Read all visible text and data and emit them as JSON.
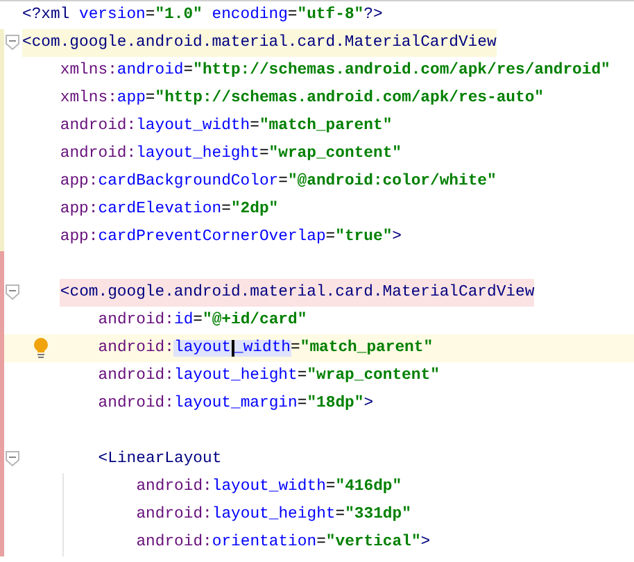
{
  "lines": [
    {
      "tokens": [
        {
          "kind": "bracket",
          "text": "<?"
        },
        {
          "kind": "tag",
          "text": "xml"
        },
        {
          "kind": "attr",
          "text": "version",
          "spaced": true
        },
        {
          "kind": "eq",
          "text": "="
        },
        {
          "kind": "value",
          "text": "\"1.0\""
        },
        {
          "kind": "attr",
          "text": "encoding",
          "spaced": true
        },
        {
          "kind": "eq",
          "text": "="
        },
        {
          "kind": "value",
          "text": "\"utf-8\""
        },
        {
          "kind": "bracket",
          "text": "?>"
        }
      ]
    },
    {
      "fold": true,
      "matched": true,
      "color": "#f3efc8",
      "tokens": [
        {
          "kind": "bracket",
          "text": "<"
        },
        {
          "kind": "tag",
          "text": "com.google.android.material.card.MaterialCardView"
        }
      ],
      "children": [
        {
          "color": "#f3efc8",
          "tokens": [
            {
              "kind": "ns",
              "text": "xmlns:"
            },
            {
              "kind": "attr",
              "text": "android"
            },
            {
              "kind": "eq",
              "text": "="
            },
            {
              "kind": "value",
              "text": "\"http://schemas.android.com/apk/res/android\""
            }
          ]
        },
        {
          "color": "#f3efc8",
          "tokens": [
            {
              "kind": "ns",
              "text": "xmlns:"
            },
            {
              "kind": "attr",
              "text": "app"
            },
            {
              "kind": "eq",
              "text": "="
            },
            {
              "kind": "value",
              "text": "\"http://schemas.android.com/apk/res-auto\""
            }
          ]
        },
        {
          "color": "#f3efc8",
          "tokens": [
            {
              "kind": "ns",
              "text": "android:"
            },
            {
              "kind": "attr",
              "text": "layout_width"
            },
            {
              "kind": "eq",
              "text": "="
            },
            {
              "kind": "value",
              "text": "\"match_parent\""
            }
          ]
        },
        {
          "color": "#f3efc8",
          "tokens": [
            {
              "kind": "ns",
              "text": "android:"
            },
            {
              "kind": "attr",
              "text": "layout_height"
            },
            {
              "kind": "eq",
              "text": "="
            },
            {
              "kind": "value",
              "text": "\"wrap_content\""
            }
          ]
        },
        {
          "color": "#f3efc8",
          "tokens": [
            {
              "kind": "ns",
              "text": "app:"
            },
            {
              "kind": "attr",
              "text": "cardBackgroundColor"
            },
            {
              "kind": "eq",
              "text": "="
            },
            {
              "kind": "value",
              "text": "\"@android:color/white\""
            }
          ]
        },
        {
          "color": "#f3efc8",
          "tokens": [
            {
              "kind": "ns",
              "text": "app:"
            },
            {
              "kind": "attr",
              "text": "cardElevation"
            },
            {
              "kind": "eq",
              "text": "="
            },
            {
              "kind": "value",
              "text": "\"2dp\""
            }
          ]
        },
        {
          "color": "#f3efc8",
          "tokens": [
            {
              "kind": "ns",
              "text": "app:"
            },
            {
              "kind": "attr",
              "text": "cardPreventCornerOverlap"
            },
            {
              "kind": "eq",
              "text": "="
            },
            {
              "kind": "value",
              "text": "\"true\""
            },
            {
              "kind": "bracket",
              "text": ">"
            }
          ]
        },
        {
          "color": "#e8a0a0"
        },
        {
          "fold": true,
          "error": true,
          "color": "#e8a0a0",
          "tokens": [
            {
              "kind": "bracket",
              "text": "<"
            },
            {
              "kind": "tag",
              "text": "com.google.android.material.card.MaterialCardView"
            }
          ],
          "children": [
            {
              "color": "#e8a0a0",
              "tokens": [
                {
                  "kind": "ns",
                  "text": "android:"
                },
                {
                  "kind": "attr",
                  "text": "id"
                },
                {
                  "kind": "eq",
                  "text": "="
                },
                {
                  "kind": "value",
                  "text": "\"@+id/card\""
                }
              ]
            },
            {
              "color": "#e8a0a0",
              "bulb": true,
              "current": true,
              "tokens": [
                {
                  "kind": "ns",
                  "text": "android:"
                },
                {
                  "kind": "attr",
                  "text": "layout",
                  "selected": true
                },
                {
                  "kind": "attr",
                  "text": "_width",
                  "selected": true,
                  "caret": true
                },
                {
                  "kind": "eq",
                  "text": "="
                },
                {
                  "kind": "value",
                  "text": "\"match_parent\""
                }
              ]
            },
            {
              "color": "#e8a0a0",
              "tokens": [
                {
                  "kind": "ns",
                  "text": "android:"
                },
                {
                  "kind": "attr",
                  "text": "layout_height"
                },
                {
                  "kind": "eq",
                  "text": "="
                },
                {
                  "kind": "value",
                  "text": "\"wrap_content\""
                }
              ]
            },
            {
              "color": "#e8a0a0",
              "tokens": [
                {
                  "kind": "ns",
                  "text": "android:"
                },
                {
                  "kind": "attr",
                  "text": "layout_margin"
                },
                {
                  "kind": "eq",
                  "text": "="
                },
                {
                  "kind": "value",
                  "text": "\"18dp\""
                },
                {
                  "kind": "bracket",
                  "text": ">"
                }
              ]
            },
            {
              "color": "#e8a0a0"
            },
            {
              "fold": true,
              "color": "#e8a0a0",
              "tokens": [
                {
                  "kind": "bracket",
                  "text": "<"
                },
                {
                  "kind": "tag",
                  "text": "LinearLayout"
                }
              ],
              "children": [
                {
                  "color": "#e8a0a0",
                  "tokens": [
                    {
                      "kind": "ns",
                      "text": "android:"
                    },
                    {
                      "kind": "attr",
                      "text": "layout_width"
                    },
                    {
                      "kind": "eq",
                      "text": "="
                    },
                    {
                      "kind": "value",
                      "text": "\"416dp\""
                    }
                  ]
                },
                {
                  "color": "#e8a0a0",
                  "tokens": [
                    {
                      "kind": "ns",
                      "text": "android:"
                    },
                    {
                      "kind": "attr",
                      "text": "layout_height"
                    },
                    {
                      "kind": "eq",
                      "text": "="
                    },
                    {
                      "kind": "value",
                      "text": "\"331dp\""
                    }
                  ]
                },
                {
                  "color": "#e8a0a0",
                  "tokens": [
                    {
                      "kind": "ns",
                      "text": "android:"
                    },
                    {
                      "kind": "attr",
                      "text": "orientation"
                    },
                    {
                      "kind": "eq",
                      "text": "="
                    },
                    {
                      "kind": "value",
                      "text": "\"vertical\""
                    },
                    {
                      "kind": "bracket",
                      "text": ">"
                    }
                  ]
                }
              ]
            }
          ]
        }
      ]
    }
  ]
}
